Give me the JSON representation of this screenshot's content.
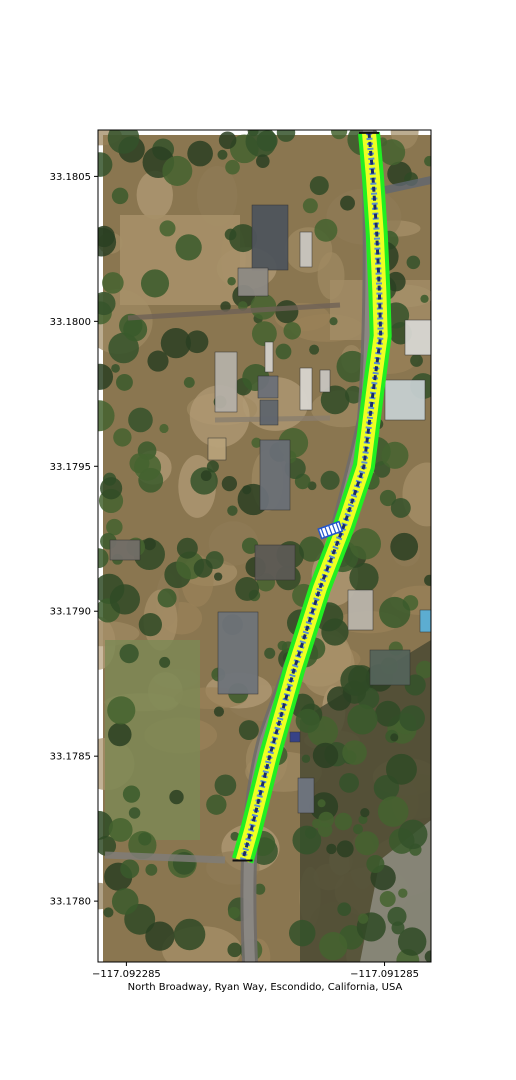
{
  "chart_data": {
    "type": "map",
    "title": "",
    "xlabel": "North Broadway, Ryan Way, Escondido, California, USA",
    "ylabel": "",
    "xlim": [
      -117.092395,
      -117.091105
    ],
    "ylim": [
      33.17779,
      33.18066
    ],
    "x_ticks": [
      {
        "value": -117.092285,
        "label": "−117.092285"
      },
      {
        "value": -117.091285,
        "label": "−117.091285"
      }
    ],
    "y_ticks": [
      {
        "value": 33.1805,
        "label": "33.1805"
      },
      {
        "value": 33.18,
        "label": "33.1800"
      },
      {
        "value": 33.1795,
        "label": "33.1795"
      },
      {
        "value": 33.179,
        "label": "33.1790"
      },
      {
        "value": 33.1785,
        "label": "33.1785"
      },
      {
        "value": 33.178,
        "label": "33.1780"
      }
    ],
    "route": [
      [
        -117.091345,
        33.18065
      ],
      [
        -117.09133,
        33.1805
      ],
      [
        -117.091315,
        33.1803
      ],
      [
        -117.091305,
        33.1801
      ],
      [
        -117.0913,
        33.17995
      ],
      [
        -117.09133,
        33.17975
      ],
      [
        -117.091365,
        33.1795
      ],
      [
        -117.09144,
        33.1793
      ],
      [
        -117.091535,
        33.17908
      ],
      [
        -117.091635,
        33.1788
      ],
      [
        -117.09173,
        33.1785
      ],
      [
        -117.0918,
        33.17825
      ],
      [
        -117.091835,
        33.17814
      ]
    ],
    "grid": false,
    "colors": {
      "route_outer": "#22ee22",
      "route_inner": "#eeff22",
      "route_center": "#1a2a6c",
      "crossing": "#2255cc"
    }
  }
}
